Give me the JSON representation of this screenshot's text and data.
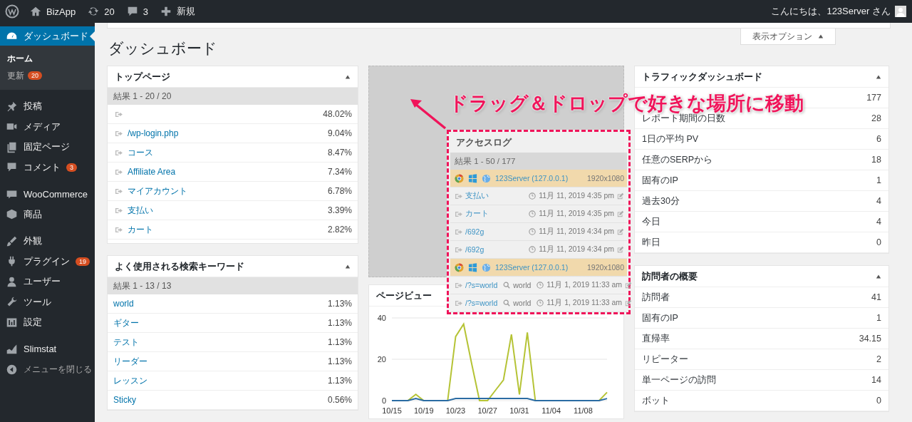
{
  "admin_bar": {
    "site": "BizApp",
    "updates": "20",
    "comments": "3",
    "new": "新規",
    "greeting": "こんにちは、123Server さん"
  },
  "sidebar": {
    "active": {
      "label": "ダッシュボード",
      "selected": true
    },
    "submenu": [
      {
        "label": "ホーム",
        "selected": true
      },
      {
        "label": "更新",
        "selected": false,
        "badge": "20"
      }
    ],
    "groups": [
      [
        {
          "label": "投稿"
        },
        {
          "label": "メディア"
        },
        {
          "label": "固定ページ"
        },
        {
          "label": "コメント",
          "badge": "3"
        }
      ],
      [
        {
          "label": "WooCommerce"
        },
        {
          "label": "商品"
        }
      ],
      [
        {
          "label": "外観"
        },
        {
          "label": "プラグイン",
          "badge": "19"
        },
        {
          "label": "ユーザー"
        },
        {
          "label": "ツール"
        },
        {
          "label": "設定"
        }
      ],
      [
        {
          "label": "Slimstat"
        }
      ]
    ],
    "collapse": "メニューを閉じる"
  },
  "screen_options": "表示オプション",
  "page_title": "ダッシュボード",
  "annotation": "ドラッグ＆ドロップで好きな場所に移動",
  "top_pages": {
    "title": "トップページ",
    "summary": "結果 1 - 20 / 20",
    "rows": [
      {
        "pct": "48.02%"
      },
      {
        "link": "/wp-login.php",
        "pct": "9.04%"
      },
      {
        "link": "コース",
        "pct": "8.47%"
      },
      {
        "link": "Affiliate Area",
        "pct": "7.34%"
      },
      {
        "link": "マイアカウント",
        "pct": "6.78%"
      },
      {
        "link": "支払い",
        "pct": "3.39%"
      },
      {
        "link": "カート",
        "pct": "2.82%"
      }
    ]
  },
  "keywords": {
    "title": "よく使用される検索キーワード",
    "summary": "結果 1 - 13 / 13",
    "rows": [
      {
        "keyword": "world",
        "pct": "1.13%"
      },
      {
        "keyword": "ギター",
        "pct": "1.13%"
      },
      {
        "keyword": "テスト",
        "pct": "1.13%"
      },
      {
        "keyword": "リーダー",
        "pct": "1.13%"
      },
      {
        "keyword": "レッスン",
        "pct": "1.13%"
      },
      {
        "keyword": "Sticky",
        "pct": "0.56%"
      }
    ]
  },
  "access_log": {
    "title": "アクセスログ",
    "summary": "結果 1 - 50 / 177",
    "rows": [
      {
        "kind": "visitor",
        "host": "123Server (127.0.0.1)",
        "resolution": "1920x1080"
      },
      {
        "kind": "page",
        "link": "支払い",
        "time": "11月 11, 2019 4:35 pm"
      },
      {
        "kind": "page",
        "link": "カート",
        "time": "11月 11, 2019 4:35 pm"
      },
      {
        "kind": "page",
        "link": "/692g",
        "time": "11月 11, 2019 4:34 pm"
      },
      {
        "kind": "page",
        "link": "/692g",
        "time": "11月 11, 2019 4:34 pm"
      },
      {
        "kind": "visitor",
        "host": "123Server (127.0.0.1)",
        "resolution": "1920x1080"
      },
      {
        "kind": "search",
        "link": "/?s=world",
        "keyword": "world",
        "time": "11月 1, 2019 11:33 am"
      },
      {
        "kind": "search",
        "link": "/?s=world",
        "keyword": "world",
        "time": "11月 1, 2019 11:33 am"
      }
    ]
  },
  "pageviews": {
    "title": "ページビュー",
    "chart_data": {
      "type": "line",
      "categories": [
        "10/15",
        null,
        null,
        null,
        "10/19",
        null,
        null,
        null,
        "10/23",
        null,
        null,
        null,
        "10/27",
        null,
        null,
        null,
        "10/31",
        null,
        null,
        null,
        "11/04",
        null,
        null,
        null,
        "11/08",
        null,
        null,
        null
      ],
      "series": [
        {
          "color": "#b5c335",
          "values": [
            0,
            0,
            0,
            3,
            0,
            0,
            0,
            0,
            31,
            37,
            18,
            0,
            0,
            5,
            10,
            32,
            3,
            33,
            0,
            0,
            0,
            0,
            0,
            0,
            0,
            0,
            0,
            4
          ]
        },
        {
          "color": "#2b6ca3",
          "values": [
            0,
            0,
            0,
            1,
            0,
            0,
            0,
            0,
            1,
            1,
            1,
            1,
            1,
            1,
            1,
            1,
            1,
            1,
            0,
            0,
            0,
            0,
            0,
            0,
            0,
            0,
            0,
            1
          ]
        }
      ],
      "ylim": [
        0,
        40
      ],
      "yticks": [
        0,
        20,
        40
      ]
    }
  },
  "traffic": {
    "title": "トラフィックダッシュボード",
    "rows": [
      {
        "value": "177"
      },
      {
        "label": "レポート期間の日数",
        "value": "28"
      },
      {
        "label": "1日の平均 PV",
        "value": "6"
      },
      {
        "label": "任意のSERPから",
        "value": "18"
      },
      {
        "label": "固有のIP",
        "value": "1"
      },
      {
        "label": "過去30分",
        "value": "4"
      },
      {
        "label": "今日",
        "value": "4"
      },
      {
        "label": "昨日",
        "value": "0"
      }
    ]
  },
  "visitors": {
    "title": "訪問者の概要",
    "rows": [
      {
        "label": "訪問者",
        "value": "41"
      },
      {
        "label": "固有のIP",
        "value": "1"
      },
      {
        "label": "直帰率",
        "value": "34.15"
      },
      {
        "label": "リピーター",
        "value": "2"
      },
      {
        "label": "単一ページの訪問",
        "value": "14"
      },
      {
        "label": "ボット",
        "value": "0"
      }
    ]
  }
}
